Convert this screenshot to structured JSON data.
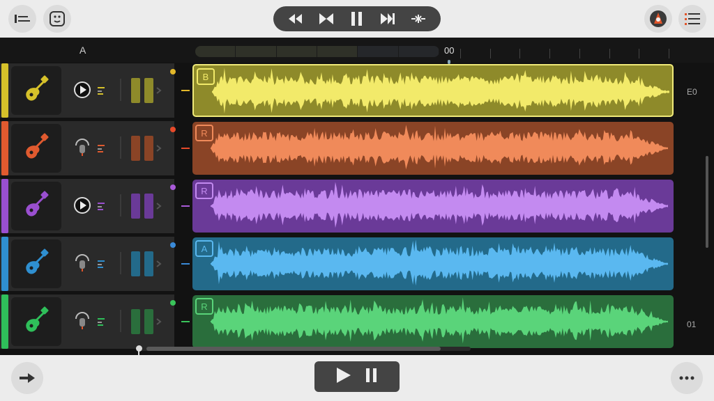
{
  "header": {
    "column_label": "A",
    "time_display": "00"
  },
  "tracks": [
    {
      "color": "#d6c12a",
      "region_label": "B",
      "region_color": "#8e8a2a",
      "wave_color": "#f2ea6a",
      "dot": "#e3b82a"
    },
    {
      "color": "#e05a2f",
      "region_label": "R",
      "region_color": "#8a4426",
      "wave_color": "#f08a5a",
      "dot": "#e64a2a"
    },
    {
      "color": "#9a4fd0",
      "region_label": "R",
      "region_color": "#6a3a98",
      "wave_color": "#c38af0",
      "dot": "#a95ad8"
    },
    {
      "color": "#2f8fd0",
      "region_label": "A",
      "region_color": "#236a8a",
      "wave_color": "#5ab8f0",
      "dot": "#3a8ad8"
    },
    {
      "color": "#2fbf5a",
      "region_label": "R",
      "region_color": "#2a6e3c",
      "wave_color": "#5ad47a",
      "dot": "#3ac45a"
    }
  ],
  "right_labels": {
    "top": "E0",
    "bottom": "01"
  },
  "icons": {
    "top_left": "tracks-view-icon",
    "top_left_2": "browser-icon",
    "transport": [
      "rewind-icon",
      "skip-back-icon",
      "pause-icon",
      "skip-forward-icon",
      "loop-icon"
    ],
    "top_right": [
      "metronome-icon",
      "list-icon"
    ],
    "bottom_left": "arrow-icon",
    "bottom_right": "more-icon"
  }
}
